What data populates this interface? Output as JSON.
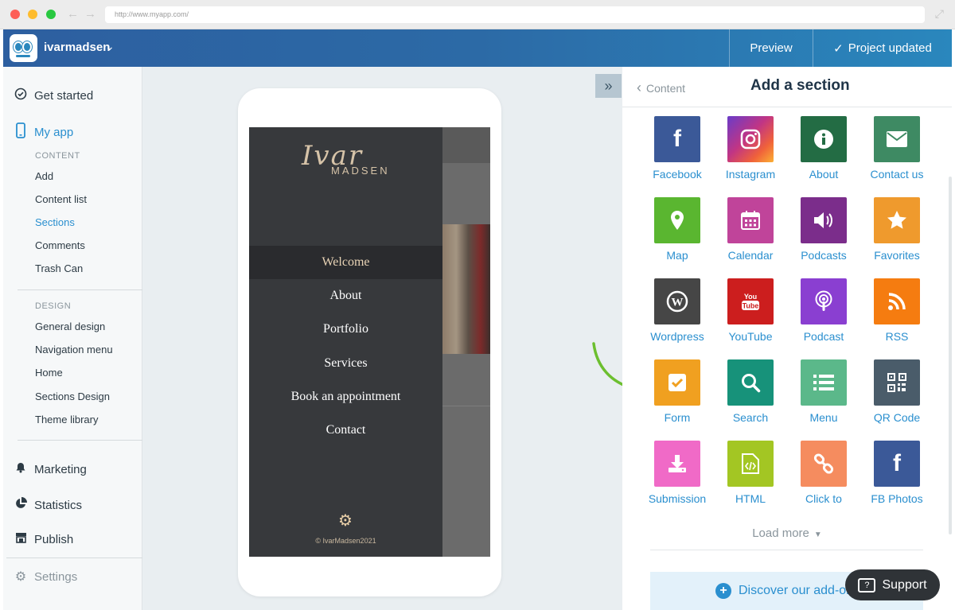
{
  "browser": {
    "url": "http://www.myapp.com/"
  },
  "topbar": {
    "account_name": "ivarmadsen",
    "preview_label": "Preview",
    "status_label": "Project updated"
  },
  "sidebar": {
    "get_started": "Get started",
    "my_app": "My app",
    "content_heading": "CONTENT",
    "content_items": [
      "Add",
      "Content list",
      "Sections",
      "Comments",
      "Trash Can"
    ],
    "design_heading": "DESIGN",
    "design_items": [
      "General design",
      "Navigation menu",
      "Home",
      "Sections Design",
      "Theme library"
    ],
    "marketing": "Marketing",
    "statistics": "Statistics",
    "publish": "Publish",
    "settings": "Settings"
  },
  "preview": {
    "logo_script": "Ivar",
    "logo_caps": "MADSEN",
    "menu_items": [
      "Welcome",
      "About",
      "Portfolio",
      "Services",
      "Book an appointment",
      "Contact"
    ],
    "selected_index": 0,
    "copyright": "© IvarMadsen2021"
  },
  "panel": {
    "back_label": "Content",
    "title": "Add a section",
    "sections": [
      {
        "label": "Facebook",
        "icon": "facebook-icon",
        "color": "#3b5998"
      },
      {
        "label": "Instagram",
        "icon": "instagram-icon",
        "color": "#c13584"
      },
      {
        "label": "About",
        "icon": "info-icon",
        "color": "#236c44"
      },
      {
        "label": "Contact us",
        "icon": "envelope-icon",
        "color": "#3e8a63"
      },
      {
        "label": "Map",
        "icon": "map-pin-icon",
        "color": "#5ab630"
      },
      {
        "label": "Calendar",
        "icon": "calendar-icon",
        "color": "#c0449a"
      },
      {
        "label": "Podcasts",
        "icon": "speaker-icon",
        "color": "#7b2d8b"
      },
      {
        "label": "Favorites",
        "icon": "star-icon",
        "color": "#ef9a2d"
      },
      {
        "label": "Wordpress",
        "icon": "wordpress-icon",
        "color": "#464646"
      },
      {
        "label": "YouTube",
        "icon": "youtube-icon",
        "color": "#cc1e1e"
      },
      {
        "label": "Podcast",
        "icon": "podcast-icon",
        "color": "#8a3fd1"
      },
      {
        "label": "RSS",
        "icon": "rss-icon",
        "color": "#f57c10"
      },
      {
        "label": "Form",
        "icon": "checkbox-icon",
        "color": "#f0a020"
      },
      {
        "label": "Search",
        "icon": "search-icon",
        "color": "#17927a"
      },
      {
        "label": "Menu",
        "icon": "list-icon",
        "color": "#5bb88a"
      },
      {
        "label": "QR Code",
        "icon": "qr-code-icon",
        "color": "#4a5c6a"
      },
      {
        "label": "Submission",
        "icon": "download-icon",
        "color": "#f06ac7"
      },
      {
        "label": "HTML",
        "icon": "code-file-icon",
        "color": "#a3c623"
      },
      {
        "label": "Click to",
        "icon": "link-icon",
        "color": "#f58c5f"
      },
      {
        "label": "FB Photos",
        "icon": "facebook-icon",
        "color": "#3b5998"
      }
    ],
    "load_more": "Load more",
    "discover": "Discover our add-ons"
  },
  "support": {
    "label": "Support"
  }
}
